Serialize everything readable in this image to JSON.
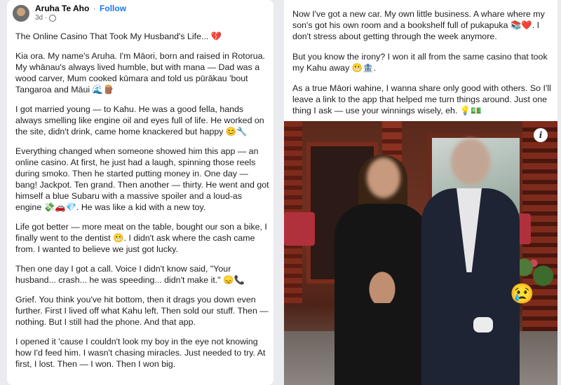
{
  "post": {
    "author": "Aruha Te Aho",
    "separator": "·",
    "follow_label": "Follow",
    "time": "3d ·",
    "paragraphs_left": [
      "The Online Casino That Took My Husband's Life... 💔",
      "Kia ora. My name's Aruha. I'm Māori, born and raised in Rotorua. My whānau's always lived humble, but with mana — Dad was a wood carver, Mum cooked kūmara and told us pūrākau 'bout Tangaroa and Māui 🌊🪵",
      "I got married young — to Kahu. He was a good fella, hands always smelling like engine oil and eyes full of life. He worked on the site, didn't drink, came home knackered but happy 😊🔧",
      "Everything changed when someone showed him this app — an online casino. At first, he just had a laugh, spinning those reels during smoko. Then he started putting money in. One day — bang! Jackpot. Ten grand. Then another — thirty. He went and got himself a blue Subaru with a massive spoiler and a loud-as engine 💸🚗💎. He was like a kid with a new toy.",
      "Life got better — more meat on the table, bought our son a bike, I finally went to the dentist 😬. I didn't ask where the cash came from. I wanted to believe we just got lucky.",
      "Then one day I got a call. Voice I didn't know said, \"Your husband... crash... he was speeding... didn't make it.\" 😞📞",
      "Grief. You think you've hit bottom, then it drags you down even further. First I lived off what Kahu left. Then sold our stuff. Then — nothing. But I still had the phone. And that app.",
      "I opened it 'cause I couldn't look my boy in the eye not knowing how I'd feed him. I wasn't chasing miracles. Just needed to try. At first, I lost. Then — I won. Then I won big."
    ],
    "paragraphs_right": [
      "Now I've got a new car. My own little business. A whare where my son's got his own room and a bookshelf full of pukapuka 📚❤️. I don't stress about getting through the week anymore.",
      "But you know the irony? I won it all from the same casino that took my Kahu away 😬🏦.",
      "As a true Māori wahine, I wanna share only good with others. So I'll leave a link to the app that helped me turn things around. Just one thing I ask — use your winnings wisely, eh. 💡💵"
    ]
  },
  "photo": {
    "info_icon": "i",
    "reaction_emoji": "😢"
  }
}
